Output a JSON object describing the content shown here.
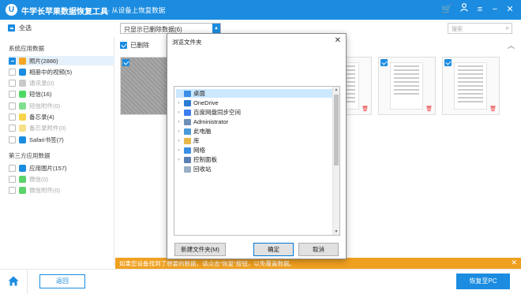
{
  "app": {
    "logo": "U",
    "title": "牛学长苹果数据恢复工具",
    "subtitle": "- 从设备上恢复数据",
    "controls": [
      "cart-icon",
      "user-icon",
      "menu-icon",
      "minimize-icon",
      "close-icon"
    ]
  },
  "toolbar": {
    "select_all": "全选",
    "filter": "只显示已删除数据(6)",
    "search_placeholder": "搜索"
  },
  "sidebar": {
    "system_section": "系统应用数据",
    "system_items": [
      {
        "label": "照片(2886)",
        "state": "partial",
        "selected": true,
        "disabled": false,
        "color": "#f5a623"
      },
      {
        "label": "相册中的视频(5)",
        "state": "empty",
        "selected": false,
        "disabled": false,
        "color": "#1b8ce0"
      },
      {
        "label": "通讯录(0)",
        "state": "empty",
        "selected": false,
        "disabled": true,
        "color": "#c9c9c9"
      },
      {
        "label": "短信(16)",
        "state": "empty",
        "selected": false,
        "disabled": false,
        "color": "#4cd964"
      },
      {
        "label": "短信附件(0)",
        "state": "empty",
        "selected": false,
        "disabled": true,
        "color": "#7fdf8f"
      },
      {
        "label": "备忘录(4)",
        "state": "empty",
        "selected": false,
        "disabled": false,
        "color": "#f7d34a"
      },
      {
        "label": "备忘录附件(0)",
        "state": "empty",
        "selected": false,
        "disabled": true,
        "color": "#f7e08a"
      },
      {
        "label": "Safari书签(7)",
        "state": "empty",
        "selected": false,
        "disabled": false,
        "color": "#1b8ce0"
      }
    ],
    "third_section": "第三方应用数据",
    "third_items": [
      {
        "label": "应用图片(157)",
        "state": "empty",
        "selected": false,
        "disabled": false,
        "color": "#1b8ce0"
      },
      {
        "label": "微信(0)",
        "state": "empty",
        "selected": false,
        "disabled": true,
        "color": "#5bd36a"
      },
      {
        "label": "微信附件(0)",
        "state": "empty",
        "selected": false,
        "disabled": true,
        "color": "#5bd36a"
      }
    ]
  },
  "main": {
    "deleted_label": "已删除",
    "warning": "如果您设备找到了想要的数据，请点击\"恢复\"按钮，以免覆盖数据。"
  },
  "dialog": {
    "title": "浏览文件夹",
    "tree": [
      {
        "label": "桌面",
        "expander": "",
        "selected": true,
        "color": "#3a8ee6"
      },
      {
        "label": "OneDrive",
        "expander": "›",
        "selected": false,
        "color": "#2b7cd3"
      },
      {
        "label": "百度网盘同步空间",
        "expander": "›",
        "selected": false,
        "color": "#3d7ef0"
      },
      {
        "label": "Administrator",
        "expander": "›",
        "selected": false,
        "color": "#6d8fb8"
      },
      {
        "label": "此电脑",
        "expander": "›",
        "selected": false,
        "color": "#4a9ad8"
      },
      {
        "label": "库",
        "expander": "›",
        "selected": false,
        "color": "#e8b84a"
      },
      {
        "label": "网络",
        "expander": "›",
        "selected": false,
        "color": "#3a8ee6"
      },
      {
        "label": "控制面板",
        "expander": "›",
        "selected": false,
        "color": "#5a7fb5"
      },
      {
        "label": "回收站",
        "expander": "",
        "selected": false,
        "color": "#9ab0c6"
      }
    ],
    "new_folder": "新建文件夹(M)",
    "ok": "确定",
    "cancel": "取消"
  },
  "footer": {
    "back": "返回",
    "recover": "恢复至PC"
  }
}
